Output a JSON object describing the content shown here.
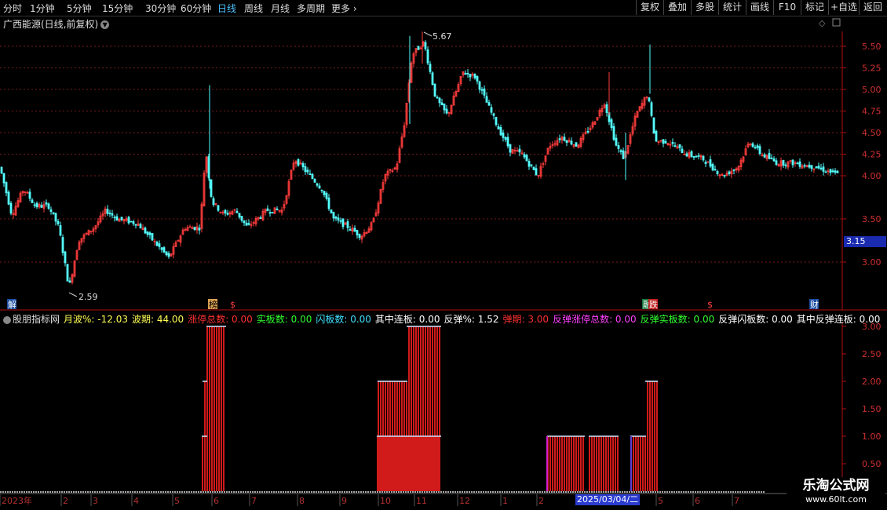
{
  "toolbar": {
    "tabs": [
      "分时",
      "1分钟",
      "5分钟",
      "15分钟",
      "30分钟",
      "60分钟",
      "日线",
      "周线",
      "月线",
      "多周期",
      "更多"
    ],
    "active_tab": "日线",
    "right_buttons": [
      "复权",
      "叠加",
      "多股",
      "统计",
      "画线",
      "F10",
      "标记",
      "+自选",
      "返回"
    ]
  },
  "chart_title": "广西能源(日线,前复权)",
  "price_axis": {
    "ticks": [
      "5.50",
      "5.25",
      "5.00",
      "4.75",
      "4.50",
      "4.25",
      "4.00",
      "3.50",
      "3.00"
    ],
    "last_price": "3.15"
  },
  "annotations": {
    "high_label": "5.67",
    "low_label": "2.59"
  },
  "markers": [
    "解",
    "榜",
    "$",
    "融",
    "跌",
    "$",
    "财"
  ],
  "indicator": {
    "name": "股朋指标网",
    "items": [
      {
        "label": "月波%:",
        "value": "-12.03",
        "color": "#ffff55"
      },
      {
        "label": "波期:",
        "value": "44.00",
        "color": "#ffff55"
      },
      {
        "label": "涨停总数:",
        "value": "0.00",
        "color": "#ff3030"
      },
      {
        "label": "实板数:",
        "value": "0.00",
        "color": "#30ff30"
      },
      {
        "label": "闪板数:",
        "value": "0.00",
        "color": "#40e0ff"
      },
      {
        "label": "其中连板:",
        "value": "0.00",
        "color": "#ffffff"
      },
      {
        "label": "反弹%:",
        "value": "1.52",
        "color": "#ffffff"
      },
      {
        "label": "弹期:",
        "value": "3.00",
        "color": "#ff3030"
      },
      {
        "label": "反弹涨停总数:",
        "value": "0.00",
        "color": "#ff40ff"
      },
      {
        "label": "反弹实板数:",
        "value": "0.00",
        "color": "#30ff30"
      },
      {
        "label": "反弹闪板数:",
        "value": "0.00",
        "color": "#ffffff"
      },
      {
        "label": "其中反弹连板:",
        "value": "0.00",
        "color": "#ffffff"
      }
    ],
    "axis_ticks": [
      "3.00",
      "2.50",
      "2.00",
      "1.50",
      "1.00",
      "0.50"
    ]
  },
  "time_axis": [
    "2023年",
    "2",
    "3",
    "4",
    "5",
    "6",
    "7",
    "8",
    "9",
    "10",
    "11",
    "12",
    "1",
    "2",
    "5",
    "6",
    "7"
  ],
  "current_date": "2025/03/04/二",
  "logo": {
    "line1": "乐淘公式网",
    "line2": "www.60lt.com"
  },
  "colors": {
    "up": "#ff3c3c",
    "down": "#54ffff",
    "grid": "#7a1a1a",
    "axis": "#b01010"
  }
}
